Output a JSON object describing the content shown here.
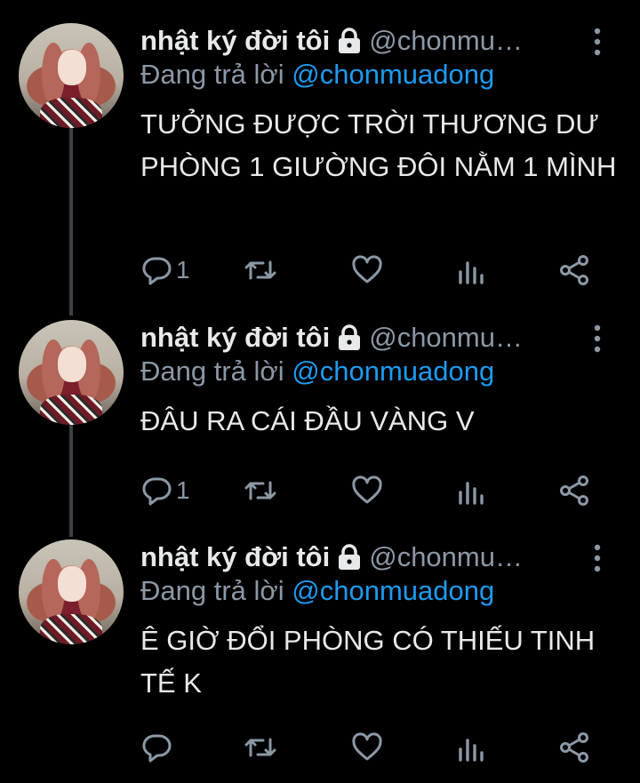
{
  "tweets": [
    {
      "name": "nhật ký đời tôi",
      "handle": "@chonmu…",
      "reply_prefix": "Đang trả lời",
      "reply_to": "@chonmuadong",
      "text": "TƯỞNG ĐƯỢC TRỜI THƯƠNG DƯ PHÒNG 1 GIƯỜNG ĐÔI NẰM 1 MÌNH",
      "reply_count": "1"
    },
    {
      "name": "nhật ký đời tôi",
      "handle": "@chonmu…",
      "reply_prefix": "Đang trả lời",
      "reply_to": "@chonmuadong",
      "text": "ĐÂU RA CÁI ĐẦU VÀNG V",
      "reply_count": "1"
    },
    {
      "name": "nhật ký đời tôi",
      "handle": "@chonmu…",
      "reply_prefix": "Đang trả lời",
      "reply_to": "@chonmuadong",
      "text": "Ê GIỜ ĐỔI PHÒNG CÓ THIẾU TINH TẾ K",
      "reply_count": ""
    }
  ],
  "colors": {
    "background": "#000000",
    "text": "#e7e9ea",
    "secondary": "#8b98a5",
    "accent": "#1d9bf0",
    "thread_line": "#3e4144"
  },
  "icons": [
    "lock-icon",
    "more-icon",
    "reply-icon",
    "retweet-icon",
    "like-icon",
    "analytics-icon",
    "share-icon"
  ]
}
